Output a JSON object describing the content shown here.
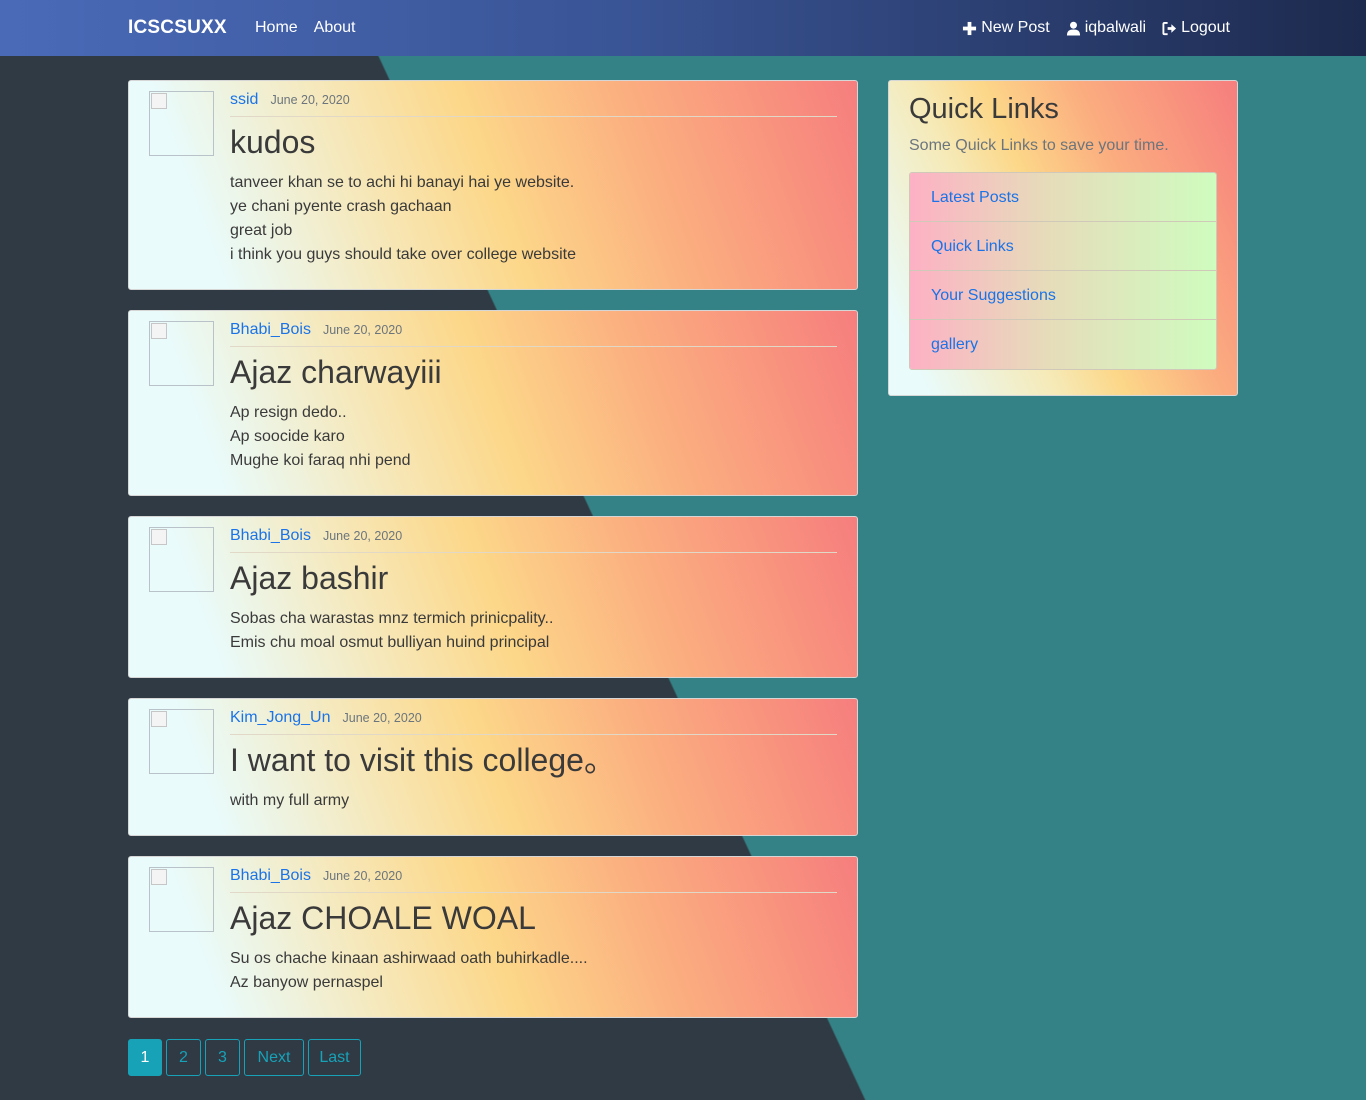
{
  "navbar": {
    "brand": "ICSCSUXX",
    "links": [
      {
        "label": "Home"
      },
      {
        "label": "About"
      }
    ],
    "right": {
      "new_post": "New Post",
      "username": "iqbalwali",
      "logout": "Logout"
    }
  },
  "posts": [
    {
      "author": "ssid",
      "date": "June 20, 2020",
      "title": "kudos",
      "lines": [
        "tanveer khan se to achi hi banayi hai ye website.",
        "ye chani pyente crash gachaan",
        "great job",
        "i think you guys should take over college website"
      ]
    },
    {
      "author": "Bhabi_Bois",
      "date": "June 20, 2020",
      "title": "Ajaz charwayiii",
      "lines": [
        "Ap resign dedo..",
        "Ap soocide karo",
        "Mughe koi faraq nhi pend"
      ]
    },
    {
      "author": "Bhabi_Bois",
      "date": "June 20, 2020",
      "title": "Ajaz bashir",
      "lines": [
        "Sobas cha warastas mnz termich prinicpality..",
        "Emis chu moal osmut bulliyan huind principal"
      ]
    },
    {
      "author": "Kim_Jong_Un",
      "date": "June 20, 2020",
      "title": "I want to visit this college。",
      "lines": [
        "with my full army"
      ]
    },
    {
      "author": "Bhabi_Bois",
      "date": "June 20, 2020",
      "title": "Ajaz CHOALE WOAL",
      "lines": [
        "Su os chache kinaan ashirwaad oath buhirkadle....",
        "Az banyow pernaspel"
      ]
    }
  ],
  "sidebar": {
    "title": "Quick Links",
    "subtitle": "Some Quick Links to save your time.",
    "links": [
      "Latest Posts",
      "Quick Links",
      "Your Suggestions",
      "gallery"
    ]
  },
  "pagination": {
    "pages": [
      "1",
      "2",
      "3"
    ],
    "active": "1",
    "next": "Next",
    "last": "Last"
  },
  "colors": {
    "accent": "#17a2b8",
    "link": "#1a73e8",
    "background_dark": "#2f3a44",
    "background_teal": "#348285"
  },
  "icons": {
    "new_post": "plus-icon",
    "user": "user-icon",
    "logout": "sign-out-icon"
  }
}
